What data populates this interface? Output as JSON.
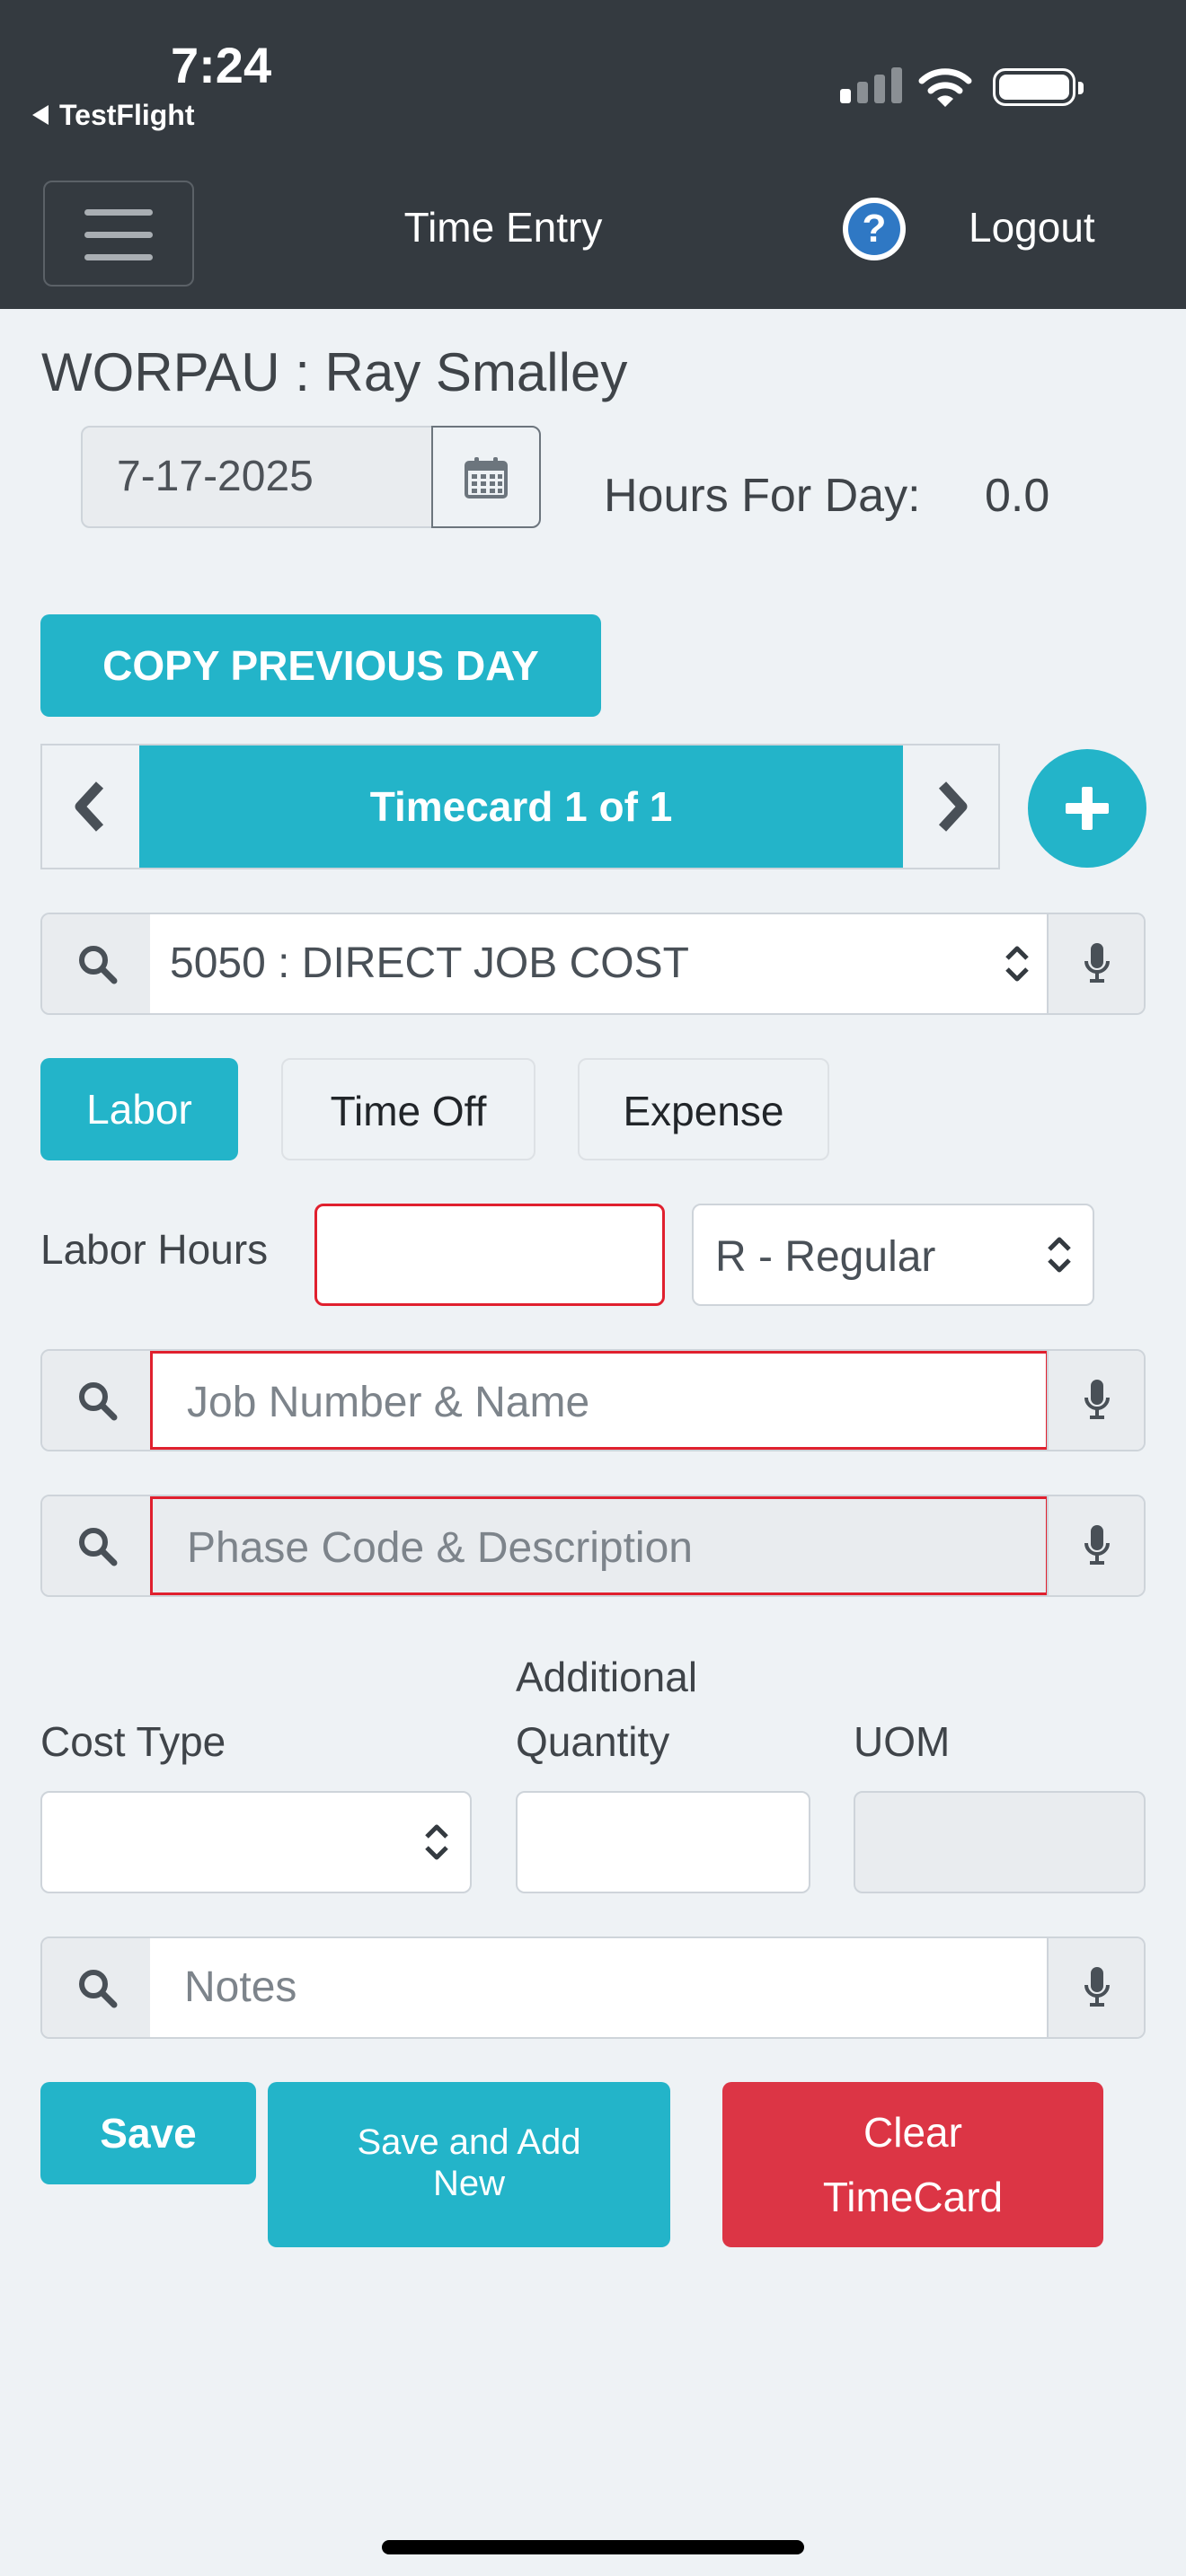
{
  "status_bar": {
    "time": "7:24",
    "back_app": "TestFlight"
  },
  "nav": {
    "title": "Time Entry",
    "help_glyph": "?",
    "logout": "Logout"
  },
  "header": {
    "user": "WORPAU : Ray Smalley"
  },
  "date": {
    "value": "7-17-2025"
  },
  "hours": {
    "label": "Hours For Day:",
    "value": "0.0"
  },
  "copy_button": "COPY PREVIOUS DAY",
  "timecard": {
    "label": "Timecard 1 of 1"
  },
  "cost_code": {
    "value": "5050 : DIRECT JOB COST"
  },
  "tabs": [
    {
      "label": "Labor",
      "active": true
    },
    {
      "label": "Time Off",
      "active": false
    },
    {
      "label": "Expense",
      "active": false
    }
  ],
  "labor": {
    "label": "Labor Hours",
    "value": "",
    "pay_type": "R - Regular"
  },
  "job": {
    "placeholder": "Job Number & Name"
  },
  "phase": {
    "placeholder": "Phase Code & Description"
  },
  "cost_type": {
    "label": "Cost Type",
    "value": ""
  },
  "additional_quantity": {
    "label_line1": "Additional",
    "label_line2": "Quantity",
    "value": ""
  },
  "uom": {
    "label": "UOM",
    "value": ""
  },
  "notes": {
    "placeholder": "Notes"
  },
  "actions": {
    "save": "Save",
    "save_and_add_new_line1": "Save and Add",
    "save_and_add_new_line2": "New",
    "clear_line1": "Clear",
    "clear_line2": "TimeCard"
  },
  "colors": {
    "accent": "#23b4c9",
    "danger": "#dc3545",
    "nav_bg": "#343a40",
    "error_border": "#e0202e",
    "help_icon": "#2f78c4"
  },
  "icons": [
    "back-triangle-icon",
    "cellular-signal-icon",
    "wifi-icon",
    "battery-icon",
    "hamburger-menu-icon",
    "help-icon",
    "calendar-icon",
    "chevron-left-icon",
    "chevron-right-icon",
    "plus-icon",
    "search-icon",
    "microphone-icon",
    "select-arrows-icon"
  ]
}
